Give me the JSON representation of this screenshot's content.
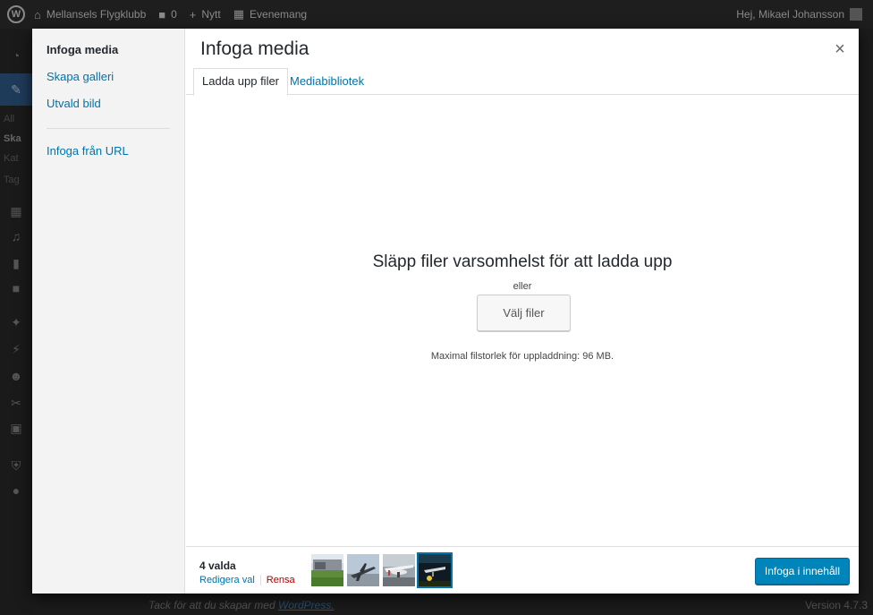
{
  "adminbar": {
    "site_name": "Mellansels Flygklubb",
    "comments_count": "0",
    "new_label": "Nytt",
    "events_label": "Evenemang",
    "greeting": "Hej, Mikael Johansson"
  },
  "adminmenu": {
    "sub_items": [
      "All",
      "Ska",
      "Kat",
      "Tag"
    ]
  },
  "footer": {
    "thanks_text": "Tack för att du skapar med ",
    "thanks_link": "WordPress.",
    "version": "Version 4.7.3"
  },
  "modal": {
    "title": "Infoga media",
    "close_label": "×",
    "menu": {
      "insert_media": "Infoga media",
      "create_gallery": "Skapa galleri",
      "featured_image": "Utvald bild",
      "insert_from_url": "Infoga från URL"
    },
    "tabs": {
      "upload": "Ladda upp filer",
      "library": "Mediabibliotek"
    },
    "upload": {
      "drop_title": "Släpp filer varsomhelst för att ladda upp",
      "or": "eller",
      "select_button": "Välj filer",
      "max_size": "Maximal filstorlek för uppladdning: 96 MB."
    },
    "toolbar": {
      "selected_count": "4 valda",
      "edit_selection": "Redigera val",
      "clear": "Rensa",
      "insert_button": "Infoga i innehåll"
    }
  },
  "colors": {
    "link": "#0073aa",
    "primary_button": "#0085ba",
    "clear_link": "#a00"
  }
}
